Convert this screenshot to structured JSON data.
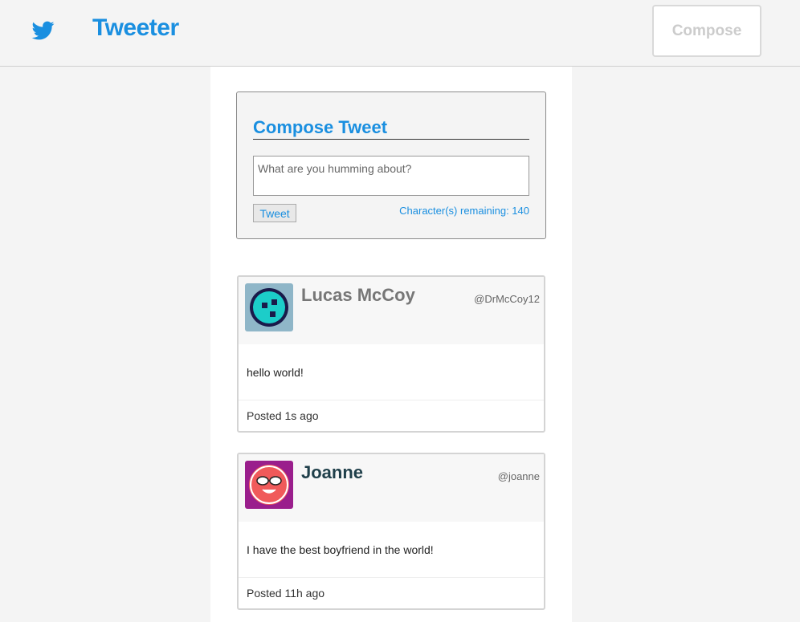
{
  "navbar": {
    "logo_icon": "twitter-bird-icon",
    "title": "Tweeter",
    "compose_label": "Compose",
    "accent_color": "#1a8fe0"
  },
  "compose": {
    "title": "Compose Tweet",
    "placeholder": "What are you humming about?",
    "value": "",
    "button_label": "Tweet",
    "counter_label": "Character(s) remaining: 140"
  },
  "tweets": [
    {
      "name": "Lucas McCoy",
      "name_color": "#777777",
      "handle": "@DrMcCoy12",
      "content": "hello world!",
      "posted": "Posted 1s ago",
      "avatar_icon": "robot-face-avatar",
      "avatar_bg": "#8fb6c8",
      "avatar_face": "#1ccdc9"
    },
    {
      "name": "Joanne",
      "name_color": "#1f3f4a",
      "handle": "@joanne",
      "content": "I have the best boyfriend in the world!",
      "posted": "Posted 11h ago",
      "avatar_icon": "sunglasses-face-avatar",
      "avatar_bg": "#9a1e8c",
      "avatar_face": "#f05a5a"
    }
  ]
}
